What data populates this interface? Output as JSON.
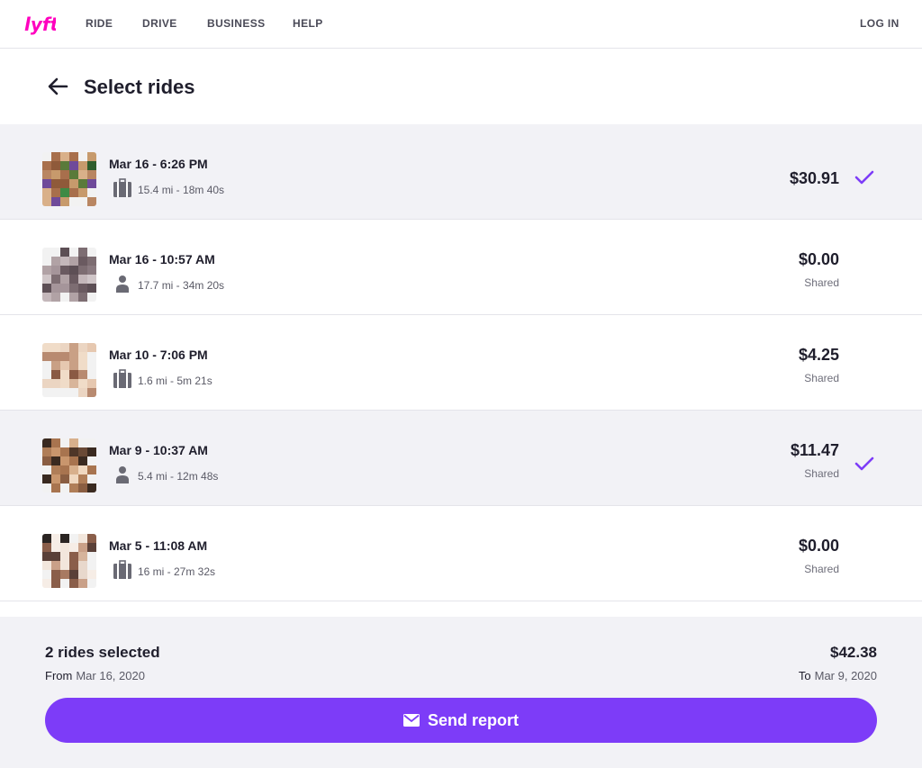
{
  "nav": {
    "brand": "lyft",
    "links": [
      "RIDE",
      "DRIVE",
      "BUSINESS",
      "HELP"
    ],
    "login": "LOG IN"
  },
  "page": {
    "title": "Select rides",
    "back_icon": "arrow-left-icon"
  },
  "rides": [
    {
      "date": "Mar 16 - 6:26 PM",
      "meta": "15.4 mi - 18m 40s",
      "ride_icon": "luggage-icon",
      "price": "$30.91",
      "sub": "",
      "selected": true
    },
    {
      "date": "Mar 16 - 10:57 AM",
      "meta": "17.7 mi - 34m 20s",
      "ride_icon": "person-icon",
      "price": "$0.00",
      "sub": "Shared",
      "selected": false
    },
    {
      "date": "Mar 10 - 7:06 PM",
      "meta": "1.6 mi - 5m 21s",
      "ride_icon": "luggage-icon",
      "price": "$4.25",
      "sub": "Shared",
      "selected": false
    },
    {
      "date": "Mar 9 - 10:37 AM",
      "meta": "5.4 mi - 12m 48s",
      "ride_icon": "person-icon",
      "price": "$11.47",
      "sub": "Shared",
      "selected": true
    },
    {
      "date": "Mar 5 - 11:08 AM",
      "meta": "16 mi - 27m 32s",
      "ride_icon": "luggage-icon",
      "price": "$0.00",
      "sub": "Shared",
      "selected": false
    }
  ],
  "summary": {
    "count": "2 rides selected",
    "total": "$42.38",
    "from_label": "From",
    "from_date": "Mar 16, 2020",
    "to_label": "To",
    "to_date": "Mar 9, 2020",
    "send_label": "Send report",
    "send_icon": "mail-icon"
  },
  "colors": {
    "brand": "#ff00bf",
    "accent": "#7d3cf8",
    "selected_bg": "#f2f2f6"
  }
}
